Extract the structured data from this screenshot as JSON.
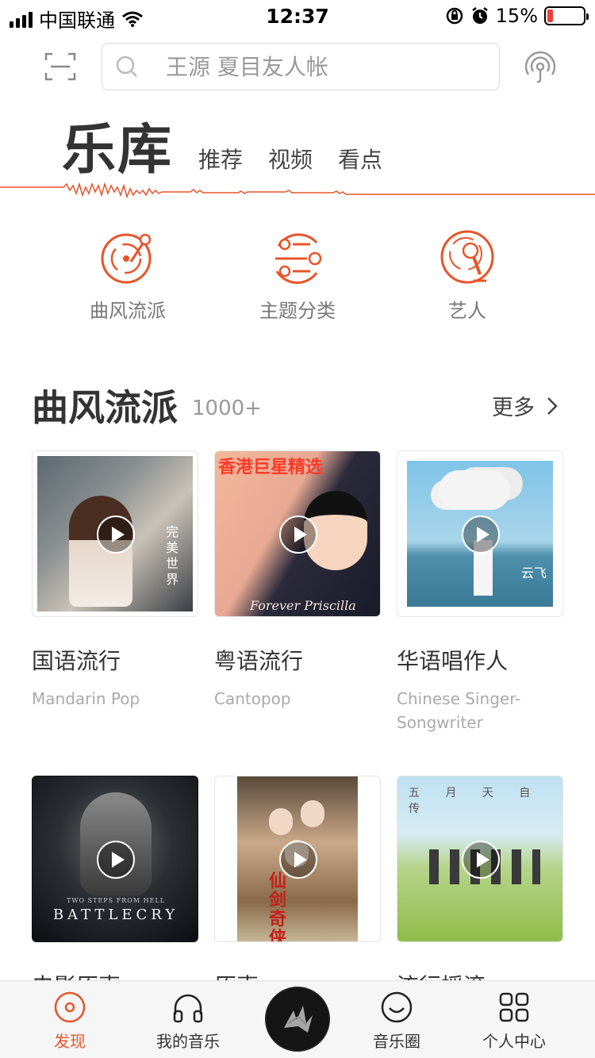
{
  "status_bar": {
    "carrier": "中国联通",
    "time": "12:37",
    "battery_percent": "15%",
    "battery_level": 0.15,
    "battery_color": "#e64340"
  },
  "search": {
    "placeholder": "王源 夏目友人帐"
  },
  "tabs": {
    "main": "乐库",
    "items": [
      "推荐",
      "视频",
      "看点"
    ],
    "accent_color": "#e8542a"
  },
  "categories": [
    {
      "label": "曲风流派",
      "icon": "turntable-icon"
    },
    {
      "label": "主题分类",
      "icon": "list-icon"
    },
    {
      "label": "艺人",
      "icon": "microphone-icon"
    }
  ],
  "section": {
    "title": "曲风流派",
    "count": "1000+",
    "more_label": "更多"
  },
  "genres": [
    {
      "title": "国语流行",
      "subtitle": "Mandarin Pop",
      "cover_text": "完美世界"
    },
    {
      "title": "粤语流行",
      "subtitle": "Cantopop",
      "cover_text": "香港巨星精选",
      "cover_sub": "Forever Priscilla"
    },
    {
      "title": "华语唱作人",
      "subtitle": "Chinese Singer-Songwriter",
      "cover_text": "云飞"
    },
    {
      "title": "电影原声",
      "subtitle": "",
      "cover_text": "BATTLECRY",
      "cover_sub": "TWO STEPS FROM HELL"
    },
    {
      "title": "原声",
      "subtitle": "",
      "cover_text": "仙剑奇侠传"
    },
    {
      "title": "流行摇滚",
      "subtitle": "",
      "cover_text": "五 月 天 自 传"
    }
  ],
  "nav": [
    {
      "label": "发现",
      "icon": "discover-icon",
      "active": true
    },
    {
      "label": "我的音乐",
      "icon": "headphones-icon",
      "active": false
    },
    {
      "label": "音乐圈",
      "icon": "smile-icon",
      "active": false
    },
    {
      "label": "个人中心",
      "icon": "grid-icon",
      "active": false
    }
  ]
}
